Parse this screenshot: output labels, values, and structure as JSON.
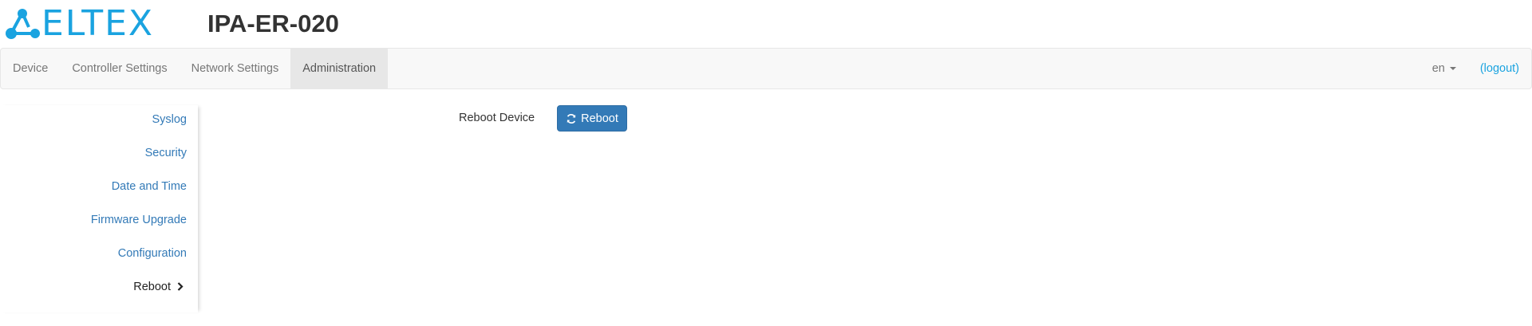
{
  "brand": {
    "logo_text": "ELTEX",
    "logo_color": "#1aa3e0"
  },
  "device": {
    "title": "IPA-ER-020"
  },
  "navbar": {
    "tabs": [
      {
        "label": "Device",
        "active": false
      },
      {
        "label": "Controller Settings",
        "active": false
      },
      {
        "label": "Network Settings",
        "active": false
      },
      {
        "label": "Administration",
        "active": true
      }
    ],
    "language": "en",
    "logout": "(logout)"
  },
  "sidebar": {
    "items": [
      {
        "label": "Syslog",
        "active": false
      },
      {
        "label": "Security",
        "active": false
      },
      {
        "label": "Date and Time",
        "active": false
      },
      {
        "label": "Firmware Upgrade",
        "active": false
      },
      {
        "label": "Configuration",
        "active": false
      },
      {
        "label": "Reboot",
        "active": true
      }
    ]
  },
  "main": {
    "reboot_label": "Reboot Device",
    "reboot_button": "Reboot",
    "button_color": "#337ab7",
    "link_color": "#337ab7"
  }
}
